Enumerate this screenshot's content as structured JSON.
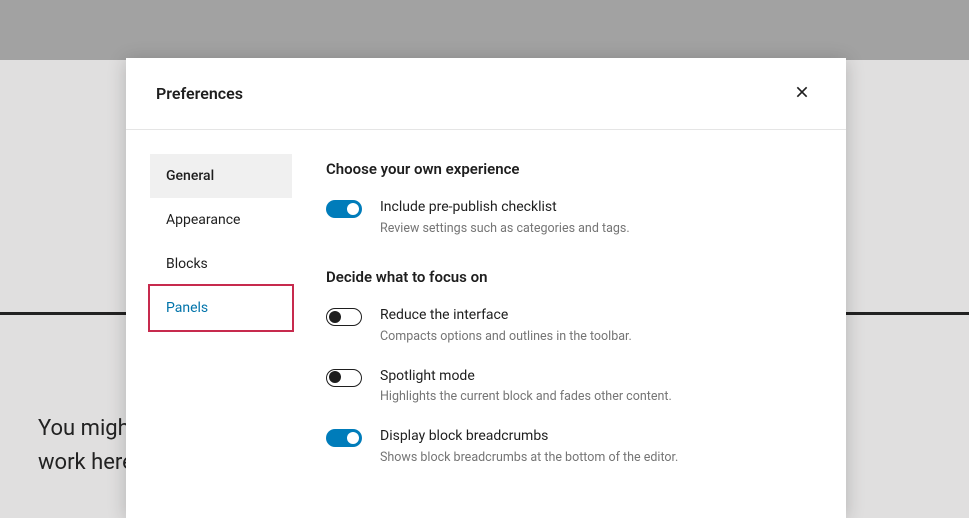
{
  "background": {
    "line1": "You migh",
    "line2": "work here"
  },
  "modal": {
    "title": "Preferences",
    "tabs": {
      "general": "General",
      "appearance": "Appearance",
      "blocks": "Blocks",
      "panels": "Panels"
    },
    "sections": {
      "s1_title": "Choose your own experience",
      "s2_title": "Decide what to focus on"
    },
    "options": {
      "prepublish": {
        "label": "Include pre-publish checklist",
        "desc": "Review settings such as categories and tags.",
        "on": true
      },
      "reduce": {
        "label": "Reduce the interface",
        "desc": "Compacts options and outlines in the toolbar.",
        "on": false
      },
      "spotlight": {
        "label": "Spotlight mode",
        "desc": "Highlights the current block and fades other content.",
        "on": false
      },
      "breadcrumbs": {
        "label": "Display block breadcrumbs",
        "desc": "Shows block breadcrumbs at the bottom of the editor.",
        "on": true
      }
    }
  }
}
